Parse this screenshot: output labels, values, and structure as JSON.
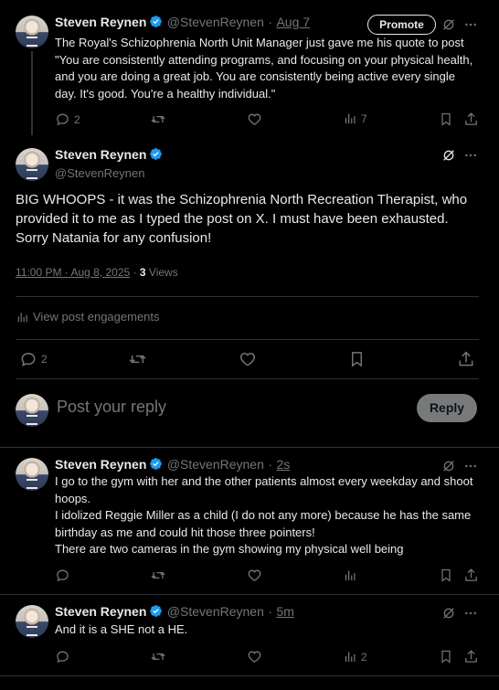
{
  "author": {
    "name": "Steven Reynen",
    "handle": "@StevenReynen"
  },
  "post1": {
    "date": "Aug 7",
    "promote_label": "Promote",
    "text": "The Royal's Schizophrenia North Unit Manager just gave me his quote to post \"You are consistently attending programs, and focusing on your physical health, and you are doing a great job. You are consistently being active every single day. It's good. You're a healthy individual.\"",
    "replies": "2",
    "views": "7"
  },
  "main_post": {
    "text": "BIG WHOOPS - it was the Schizophrenia North Recreation Therapist, who provided it to me as I typed the post on X. I must have been exhausted. Sorry Natania for any confusion!",
    "timestamp": "11:00 PM · Aug 8, 2025",
    "separator": "·",
    "view_count": "3",
    "views_label": "Views",
    "engagements_label": "View post engagements",
    "replies": "2"
  },
  "reply_box": {
    "placeholder": "Post your reply",
    "button": "Reply"
  },
  "reply1": {
    "time": "2s",
    "lines": [
      "I go to the gym with her and the other patients almost every weekday and shoot hoops.",
      "I idolized Reggie Miller as a child (I do not any more) because he has the same birthday as me and could hit those three pointers!",
      "There are two cameras in the gym showing my physical well being"
    ]
  },
  "reply2": {
    "time": "5m",
    "text": "And it is a SHE not a HE.",
    "views": "2"
  },
  "colors": {
    "background": "#000000",
    "text": "#e7e9ea",
    "muted": "#71767b",
    "verified": "#1d9bf0",
    "divider": "#2f3336"
  }
}
